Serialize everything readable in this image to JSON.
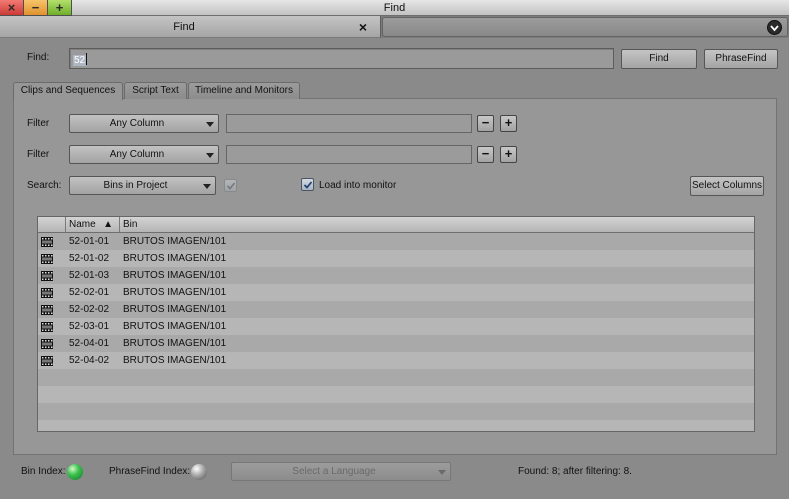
{
  "window": {
    "title": "Find",
    "controls": {
      "close": "×",
      "minimize": "−",
      "maximize": "+"
    },
    "control_colors": {
      "close": "#d9433f",
      "minimize": "#e79b36",
      "maximize": "#7cb532"
    }
  },
  "document_tab": {
    "label": "Find",
    "close": "×"
  },
  "find": {
    "label": "Find:",
    "value": "52",
    "find_button": "Find",
    "phrasefind_button": "PhraseFind"
  },
  "tabs": [
    {
      "label": "Clips and Sequences",
      "active": true
    },
    {
      "label": "Script Text",
      "active": false
    },
    {
      "label": "Timeline and Monitors",
      "active": false
    }
  ],
  "filters": [
    {
      "label": "Filter",
      "column": "Any Column",
      "value": ""
    },
    {
      "label": "Filter",
      "column": "Any Column",
      "value": ""
    }
  ],
  "filter_buttons": {
    "remove": "−",
    "add": "+"
  },
  "search": {
    "label": "Search:",
    "scope": "Bins in Project",
    "disabled_option_checked": true,
    "load_into_monitor": {
      "label": "Load into monitor",
      "checked": true
    },
    "select_columns_button": "Select Columns"
  },
  "results_table": {
    "headers": {
      "icon": "",
      "name": "Name",
      "bin": "Bin"
    },
    "sort_indicator": "▲",
    "row_icon": "clip-icon",
    "rows": [
      {
        "name": "52-01-01",
        "bin": "BRUTOS IMAGEN/101"
      },
      {
        "name": "52-01-02",
        "bin": "BRUTOS IMAGEN/101"
      },
      {
        "name": "52-01-03",
        "bin": "BRUTOS IMAGEN/101"
      },
      {
        "name": "52-02-01",
        "bin": "BRUTOS IMAGEN/101"
      },
      {
        "name": "52-02-02",
        "bin": "BRUTOS IMAGEN/101"
      },
      {
        "name": "52-03-01",
        "bin": "BRUTOS IMAGEN/101"
      },
      {
        "name": "52-04-01",
        "bin": "BRUTOS IMAGEN/101"
      },
      {
        "name": "52-04-02",
        "bin": "BRUTOS IMAGEN/101"
      }
    ]
  },
  "status": {
    "bin_index_label": "Bin Index:",
    "bin_index_color": "#2fae44",
    "phrasefind_index_label": "PhraseFind Index:",
    "phrasefind_index_color": "#a2a2a2",
    "language_select": "Select a Language",
    "found_text": "Found: 8; after filtering: 8."
  }
}
